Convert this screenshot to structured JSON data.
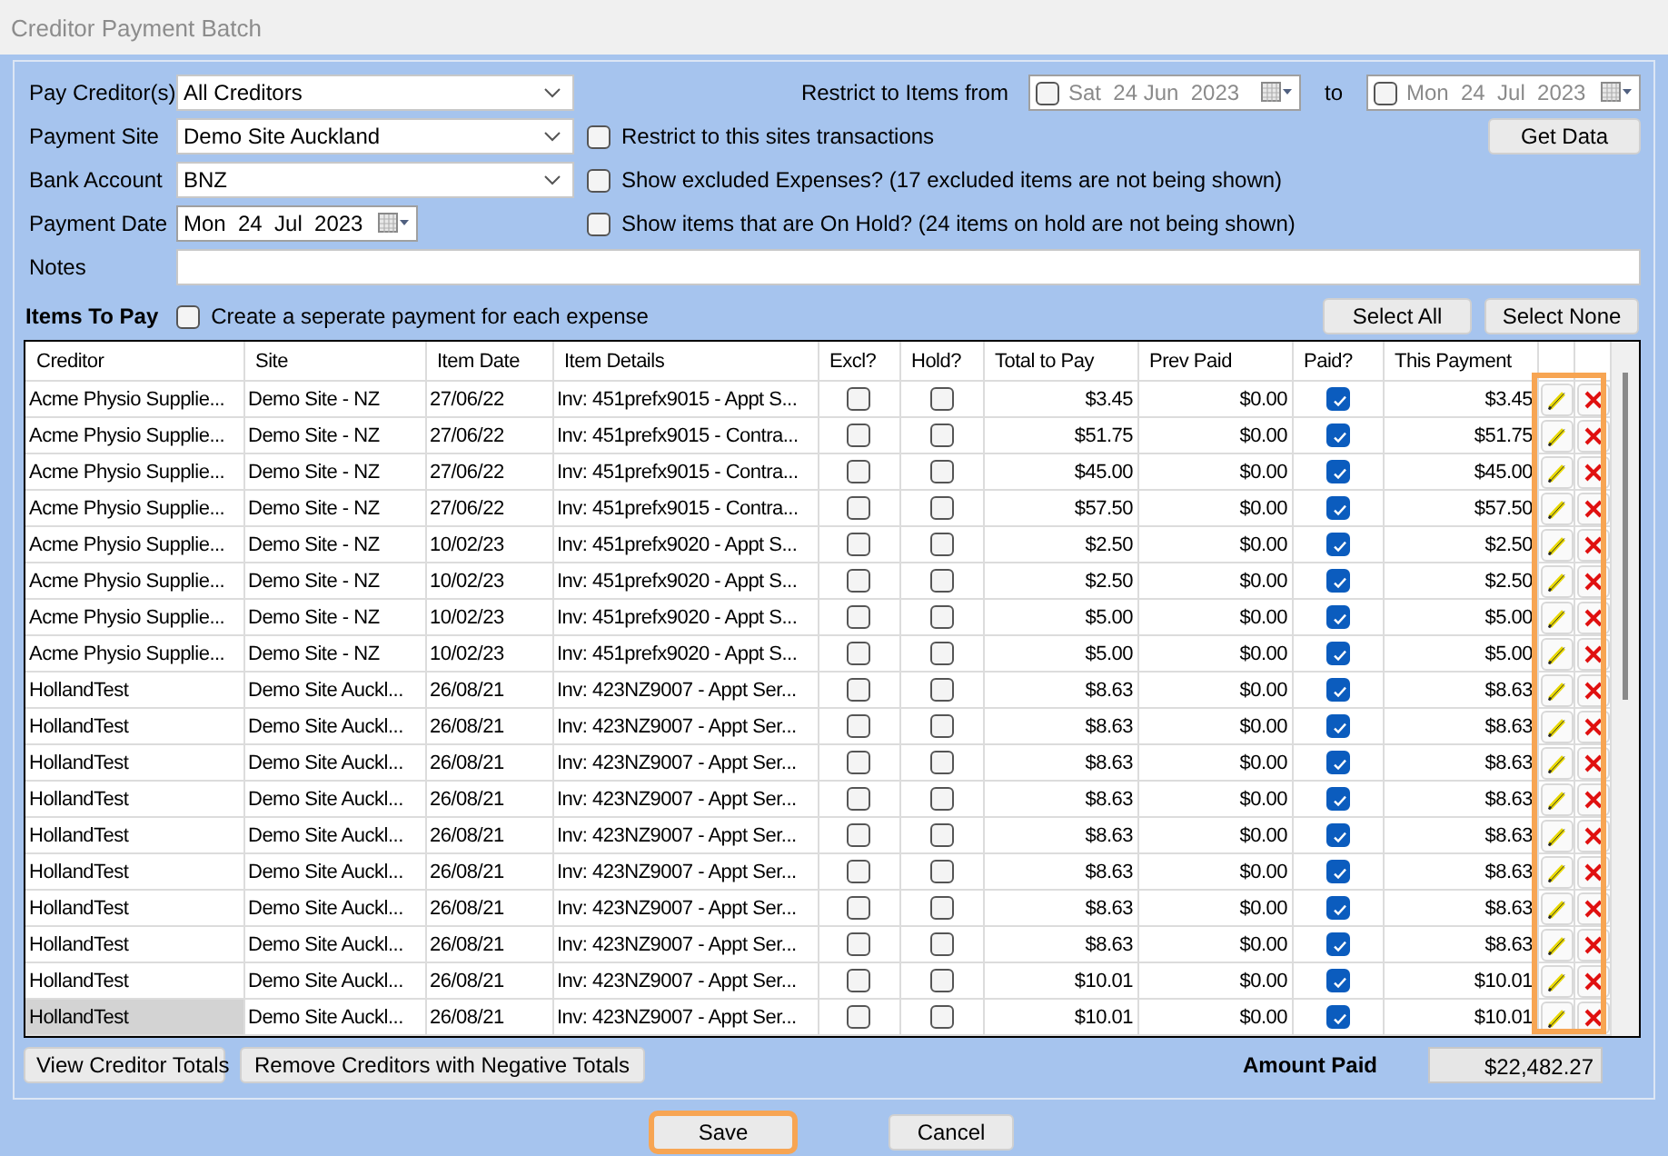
{
  "window": {
    "title": "Creditor Payment Batch"
  },
  "form": {
    "pay_creditors": {
      "label": "Pay Creditor(s)",
      "value": "All Creditors"
    },
    "payment_site": {
      "label": "Payment Site",
      "value": "Demo Site Auckland"
    },
    "bank_account": {
      "label": "Bank Account",
      "value": "BNZ"
    },
    "payment_date": {
      "label": "Payment Date",
      "value": "Mon  24  Jul  2023"
    },
    "notes": {
      "label": "Notes"
    },
    "restrict_label": "Restrict to Items from",
    "restrict_from": {
      "checked": false,
      "value": "Sat  24 Jun  2023"
    },
    "to_label": "to",
    "restrict_to": {
      "checked": false,
      "value": "Mon  24  Jul  2023"
    },
    "options": [
      {
        "label": "Restrict to this sites transactions",
        "checked": false
      },
      {
        "label": "Show excluded Expenses? (17 excluded items are not being shown)",
        "checked": false
      },
      {
        "label": "Show items that are On Hold? (24 items on hold are not being shown)",
        "checked": false
      }
    ],
    "get_data_button": "Get Data"
  },
  "items": {
    "title": "Items To Pay",
    "separate_payment": {
      "label": "Create a seperate payment for each expense",
      "checked": false
    },
    "select_all_button": "Select All",
    "select_none_button": "Select None"
  },
  "table": {
    "columns": [
      "Creditor",
      "Site",
      "Item Date",
      "Item Details",
      "Excl?",
      "Hold?",
      "Total to Pay",
      "Prev Paid",
      "Paid?",
      "This Payment"
    ],
    "actions_highlighted": true,
    "rows": [
      {
        "creditor": "Acme Physio Supplie...",
        "site": "Demo Site - NZ",
        "item_date": "27/06/22",
        "item_details": "Inv: 451prefx9015 - Appt S...",
        "excluded": false,
        "on_hold": false,
        "total_to_pay": "$3.45",
        "prev_paid": "$0.00",
        "paid": true,
        "this_payment": "$3.45",
        "selected": false
      },
      {
        "creditor": "Acme Physio Supplie...",
        "site": "Demo Site - NZ",
        "item_date": "27/06/22",
        "item_details": "Inv: 451prefx9015 - Contra...",
        "excluded": false,
        "on_hold": false,
        "total_to_pay": "$51.75",
        "prev_paid": "$0.00",
        "paid": true,
        "this_payment": "$51.75",
        "selected": false
      },
      {
        "creditor": "Acme Physio Supplie...",
        "site": "Demo Site - NZ",
        "item_date": "27/06/22",
        "item_details": "Inv: 451prefx9015 - Contra...",
        "excluded": false,
        "on_hold": false,
        "total_to_pay": "$45.00",
        "prev_paid": "$0.00",
        "paid": true,
        "this_payment": "$45.00",
        "selected": false
      },
      {
        "creditor": "Acme Physio Supplie...",
        "site": "Demo Site - NZ",
        "item_date": "27/06/22",
        "item_details": "Inv: 451prefx9015 - Contra...",
        "excluded": false,
        "on_hold": false,
        "total_to_pay": "$57.50",
        "prev_paid": "$0.00",
        "paid": true,
        "this_payment": "$57.50",
        "selected": false
      },
      {
        "creditor": "Acme Physio Supplie...",
        "site": "Demo Site - NZ",
        "item_date": "10/02/23",
        "item_details": "Inv: 451prefx9020 - Appt S...",
        "excluded": false,
        "on_hold": false,
        "total_to_pay": "$2.50",
        "prev_paid": "$0.00",
        "paid": true,
        "this_payment": "$2.50",
        "selected": false
      },
      {
        "creditor": "Acme Physio Supplie...",
        "site": "Demo Site - NZ",
        "item_date": "10/02/23",
        "item_details": "Inv: 451prefx9020 - Appt S...",
        "excluded": false,
        "on_hold": false,
        "total_to_pay": "$2.50",
        "prev_paid": "$0.00",
        "paid": true,
        "this_payment": "$2.50",
        "selected": false
      },
      {
        "creditor": "Acme Physio Supplie...",
        "site": "Demo Site - NZ",
        "item_date": "10/02/23",
        "item_details": "Inv: 451prefx9020 - Appt S...",
        "excluded": false,
        "on_hold": false,
        "total_to_pay": "$5.00",
        "prev_paid": "$0.00",
        "paid": true,
        "this_payment": "$5.00",
        "selected": false
      },
      {
        "creditor": "Acme Physio Supplie...",
        "site": "Demo Site - NZ",
        "item_date": "10/02/23",
        "item_details": "Inv: 451prefx9020 - Appt S...",
        "excluded": false,
        "on_hold": false,
        "total_to_pay": "$5.00",
        "prev_paid": "$0.00",
        "paid": true,
        "this_payment": "$5.00",
        "selected": false
      },
      {
        "creditor": "HollandTest",
        "site": "Demo Site Auckl...",
        "item_date": "26/08/21",
        "item_details": "Inv: 423NZ9007 - Appt Ser...",
        "excluded": false,
        "on_hold": false,
        "total_to_pay": "$8.63",
        "prev_paid": "$0.00",
        "paid": true,
        "this_payment": "$8.63",
        "selected": false
      },
      {
        "creditor": "HollandTest",
        "site": "Demo Site Auckl...",
        "item_date": "26/08/21",
        "item_details": "Inv: 423NZ9007 - Appt Ser...",
        "excluded": false,
        "on_hold": false,
        "total_to_pay": "$8.63",
        "prev_paid": "$0.00",
        "paid": true,
        "this_payment": "$8.63",
        "selected": false
      },
      {
        "creditor": "HollandTest",
        "site": "Demo Site Auckl...",
        "item_date": "26/08/21",
        "item_details": "Inv: 423NZ9007 - Appt Ser...",
        "excluded": false,
        "on_hold": false,
        "total_to_pay": "$8.63",
        "prev_paid": "$0.00",
        "paid": true,
        "this_payment": "$8.63",
        "selected": false
      },
      {
        "creditor": "HollandTest",
        "site": "Demo Site Auckl...",
        "item_date": "26/08/21",
        "item_details": "Inv: 423NZ9007 - Appt Ser...",
        "excluded": false,
        "on_hold": false,
        "total_to_pay": "$8.63",
        "prev_paid": "$0.00",
        "paid": true,
        "this_payment": "$8.63",
        "selected": false
      },
      {
        "creditor": "HollandTest",
        "site": "Demo Site Auckl...",
        "item_date": "26/08/21",
        "item_details": "Inv: 423NZ9007 - Appt Ser...",
        "excluded": false,
        "on_hold": false,
        "total_to_pay": "$8.63",
        "prev_paid": "$0.00",
        "paid": true,
        "this_payment": "$8.63",
        "selected": false
      },
      {
        "creditor": "HollandTest",
        "site": "Demo Site Auckl...",
        "item_date": "26/08/21",
        "item_details": "Inv: 423NZ9007 - Appt Ser...",
        "excluded": false,
        "on_hold": false,
        "total_to_pay": "$8.63",
        "prev_paid": "$0.00",
        "paid": true,
        "this_payment": "$8.63",
        "selected": false
      },
      {
        "creditor": "HollandTest",
        "site": "Demo Site Auckl...",
        "item_date": "26/08/21",
        "item_details": "Inv: 423NZ9007 - Appt Ser...",
        "excluded": false,
        "on_hold": false,
        "total_to_pay": "$8.63",
        "prev_paid": "$0.00",
        "paid": true,
        "this_payment": "$8.63",
        "selected": false
      },
      {
        "creditor": "HollandTest",
        "site": "Demo Site Auckl...",
        "item_date": "26/08/21",
        "item_details": "Inv: 423NZ9007 - Appt Ser...",
        "excluded": false,
        "on_hold": false,
        "total_to_pay": "$8.63",
        "prev_paid": "$0.00",
        "paid": true,
        "this_payment": "$8.63",
        "selected": false
      },
      {
        "creditor": "HollandTest",
        "site": "Demo Site Auckl...",
        "item_date": "26/08/21",
        "item_details": "Inv: 423NZ9007 - Appt Ser...",
        "excluded": false,
        "on_hold": false,
        "total_to_pay": "$10.01",
        "prev_paid": "$0.00",
        "paid": true,
        "this_payment": "$10.01",
        "selected": false
      },
      {
        "creditor": "HollandTest",
        "site": "Demo Site Auckl...",
        "item_date": "26/08/21",
        "item_details": "Inv: 423NZ9007 - Appt Ser...",
        "excluded": false,
        "on_hold": false,
        "total_to_pay": "$10.01",
        "prev_paid": "$0.00",
        "paid": true,
        "this_payment": "$10.01",
        "selected": true
      }
    ]
  },
  "bottom": {
    "view_totals_button": "View Creditor Totals",
    "remove_negative_button": "Remove Creditors with Negative Totals",
    "amount_paid_label": "Amount Paid",
    "amount_paid": "$22,482.27"
  },
  "footer": {
    "save_button": {
      "label": "Save",
      "highlighted": true
    },
    "cancel_button": {
      "label": "Cancel",
      "highlighted": false
    }
  }
}
